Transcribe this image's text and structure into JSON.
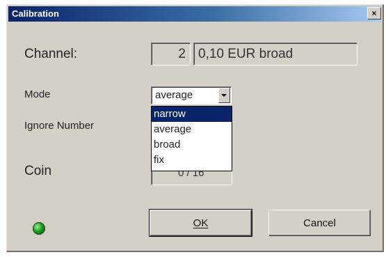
{
  "window": {
    "title": "Calibration",
    "close_symbol": "×"
  },
  "channel": {
    "label": "Channel:",
    "number": "2",
    "description": "0,10 EUR broad"
  },
  "mode": {
    "label": "Mode",
    "selected_value": "average",
    "options": [
      "narrow",
      "average",
      "broad",
      "fix"
    ],
    "highlighted_option": "narrow"
  },
  "ignore_number": {
    "label": "Ignore Number"
  },
  "coin": {
    "label": "Coin",
    "value": "0 / 16"
  },
  "status": {
    "indicator_color": "#1aa31a",
    "icon": "green-led-icon"
  },
  "buttons": {
    "ok": "OK",
    "cancel": "Cancel"
  }
}
